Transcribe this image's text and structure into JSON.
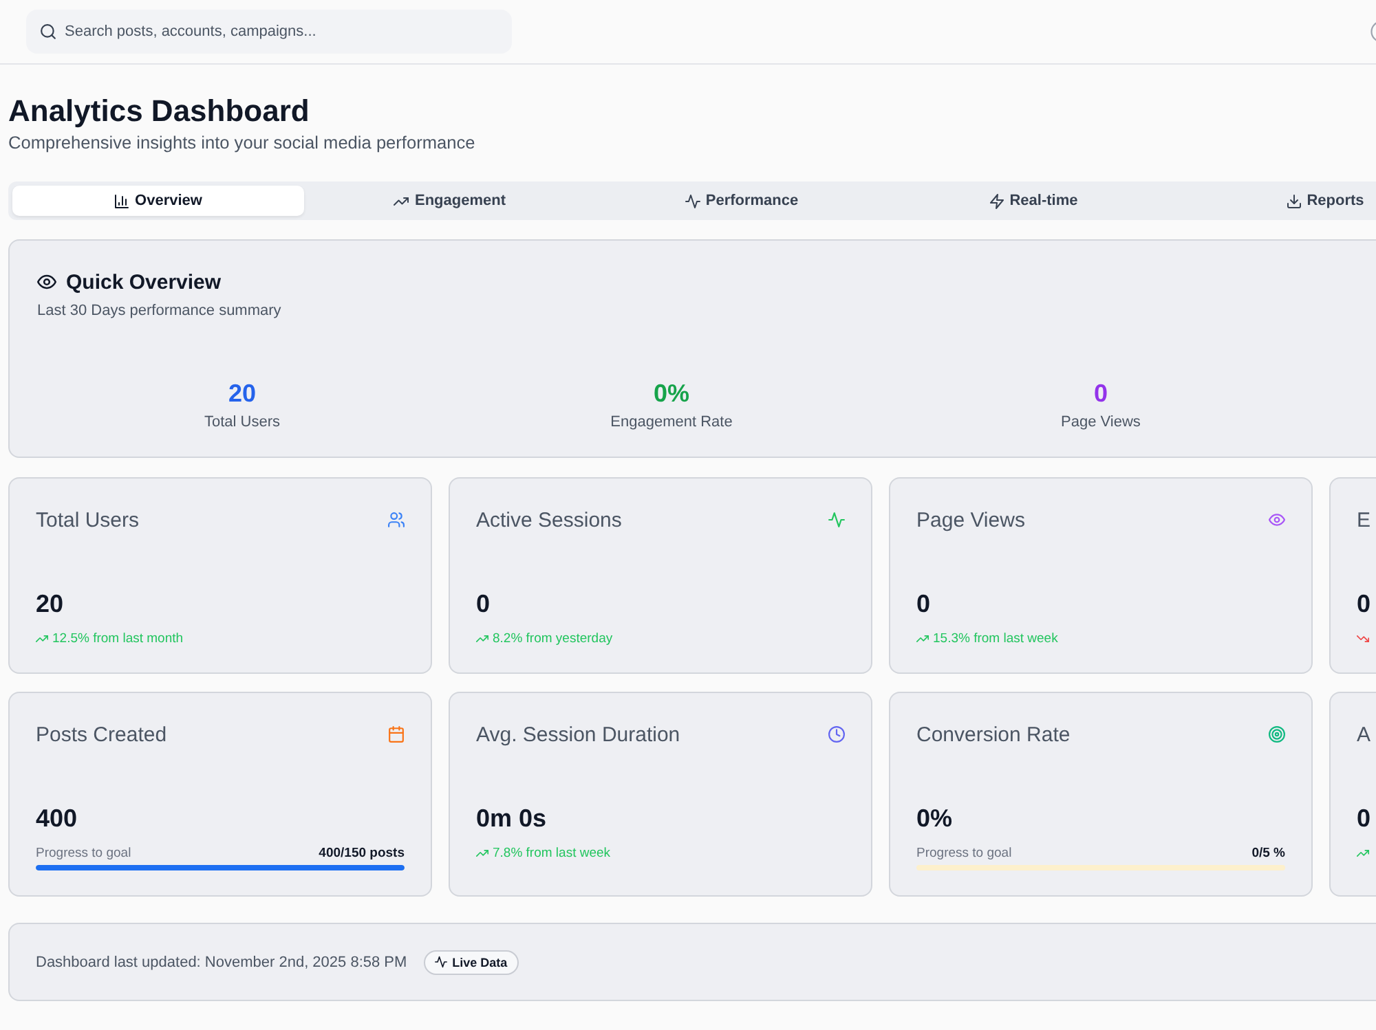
{
  "search": {
    "placeholder": "Search posts, accounts, campaigns..."
  },
  "header": {
    "title": "Analytics Dashboard",
    "subtitle": "Comprehensive insights into your social media performance"
  },
  "tabs": [
    {
      "label": "Overview",
      "selected": true
    },
    {
      "label": "Engagement",
      "selected": false
    },
    {
      "label": "Performance",
      "selected": false
    },
    {
      "label": "Real-time",
      "selected": false
    },
    {
      "label": "Reports",
      "selected": false
    }
  ],
  "quick_overview": {
    "title": "Quick Overview",
    "subtitle": "Last 30 Days performance summary",
    "stats": [
      {
        "value": "20",
        "label": "Total Users",
        "color": "#2563eb"
      },
      {
        "value": "0%",
        "label": "Engagement Rate",
        "color": "#16a34a"
      },
      {
        "value": "0",
        "label": "Page Views",
        "color": "#9333ea"
      }
    ]
  },
  "cards": [
    {
      "title": "Total Users",
      "color": "#3b82f6",
      "value": "20",
      "footer": {
        "kind": "trend",
        "negative": false,
        "text": "12.5% from last month"
      }
    },
    {
      "title": "Active Sessions",
      "color": "#22c55e",
      "value": "0",
      "footer": {
        "kind": "trend",
        "negative": false,
        "text": "8.2% from yesterday"
      }
    },
    {
      "title": "Page Views",
      "color": "#a855f7",
      "value": "0",
      "footer": {
        "kind": "trend",
        "negative": false,
        "text": "15.3% from last week"
      }
    },
    {
      "title": "E",
      "value": "0",
      "footer": {
        "kind": "trend",
        "negative": true
      }
    },
    {
      "title": "Posts Created",
      "color": "#f97316",
      "value": "400",
      "footer": {
        "kind": "progress",
        "label": "Progress to goal",
        "reading": "400/150 posts",
        "level": 1
      }
    },
    {
      "title": "Avg. Session Duration",
      "color": "#6366f1",
      "value": "0m 0s",
      "footer": {
        "kind": "trend",
        "negative": false,
        "text": "7.8% from last week"
      }
    },
    {
      "title": "Conversion Rate",
      "color": "#10b981",
      "value": "0%",
      "footer": {
        "kind": "progress",
        "label": "Progress to goal",
        "reading": "0/5 %",
        "level": 0
      }
    },
    {
      "title": "A",
      "value": "0",
      "footer": {
        "kind": "trend",
        "negative": false
      }
    }
  ],
  "status_bar": {
    "text": "Dashboard last updated: November 2nd, 2025 8:58 PM",
    "badge": "Live Data"
  }
}
